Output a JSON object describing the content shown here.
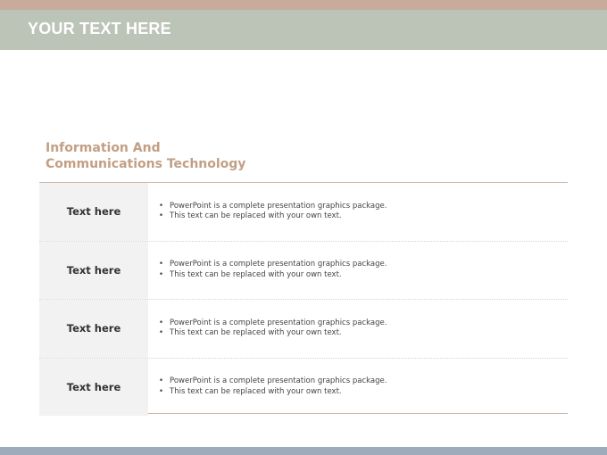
{
  "header": {
    "title": "YOUR TEXT HERE"
  },
  "section": {
    "heading_line1": "Information And",
    "heading_line2": "Communications  Technology"
  },
  "bullet_glyph": "•",
  "rows": [
    {
      "label": "Text here",
      "bullets": [
        "PowerPoint is a complete  presentation graphics package.",
        "This text can be replaced with your own text."
      ]
    },
    {
      "label": "Text here",
      "bullets": [
        "PowerPoint is a complete  presentation graphics package.",
        "This text can be replaced with your own text."
      ]
    },
    {
      "label": "Text here",
      "bullets": [
        "PowerPoint is a complete  presentation graphics package.",
        "This text can be replaced with your own text."
      ]
    },
    {
      "label": "Text here",
      "bullets": [
        "PowerPoint is a complete  presentation graphics package.",
        "This text can be replaced with your own text."
      ]
    }
  ],
  "colors": {
    "top_strip": "#c9ab9b",
    "title_bar": "#bcc3b7",
    "heading": "#c29f84",
    "bottom_strip": "#9eabbb"
  }
}
